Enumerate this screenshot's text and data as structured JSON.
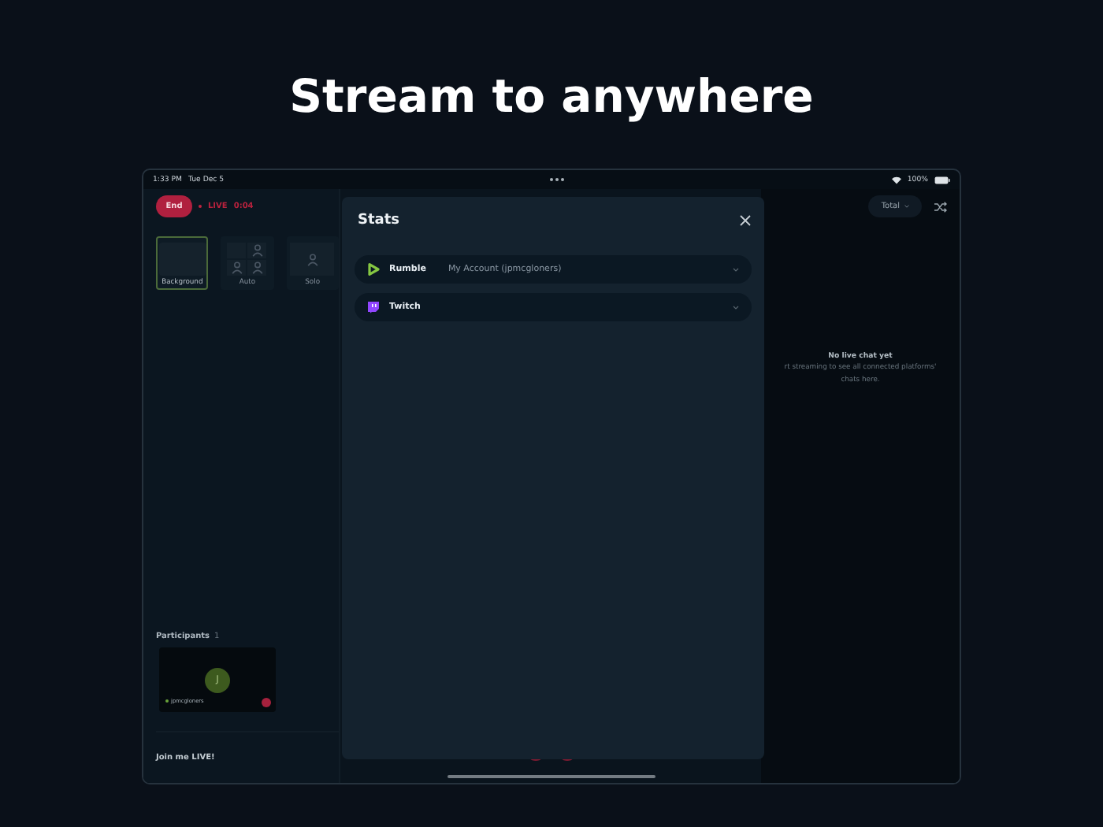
{
  "heading": "Stream to anywhere",
  "status_bar": {
    "time": "1:33 PM",
    "date": "Tue Dec 5",
    "battery": "100%"
  },
  "top_bar": {
    "end_button": "End",
    "live_label": "LIVE",
    "timer": "0:04",
    "view_select": "Total"
  },
  "layouts": [
    {
      "label": "Background",
      "kind": "background",
      "selected": true
    },
    {
      "label": "Auto",
      "kind": "auto",
      "selected": false
    },
    {
      "label": "Solo",
      "kind": "solo",
      "selected": false
    }
  ],
  "participants": {
    "title": "Participants",
    "count": "1",
    "items": [
      {
        "initial": "J",
        "name": "jpmcgloners"
      }
    ]
  },
  "stream_title": "Join me LIVE!",
  "chat": {
    "title": "No live chat yet",
    "message_lines": [
      "rt streaming to see all connected platforms'",
      "chats here."
    ]
  },
  "modal": {
    "title": "Stats",
    "platforms": [
      {
        "name": "Rumble",
        "account": "My Account (jpmcgloners)",
        "kind": "rumble"
      },
      {
        "name": "Twitch",
        "kind": "twitch"
      }
    ]
  }
}
